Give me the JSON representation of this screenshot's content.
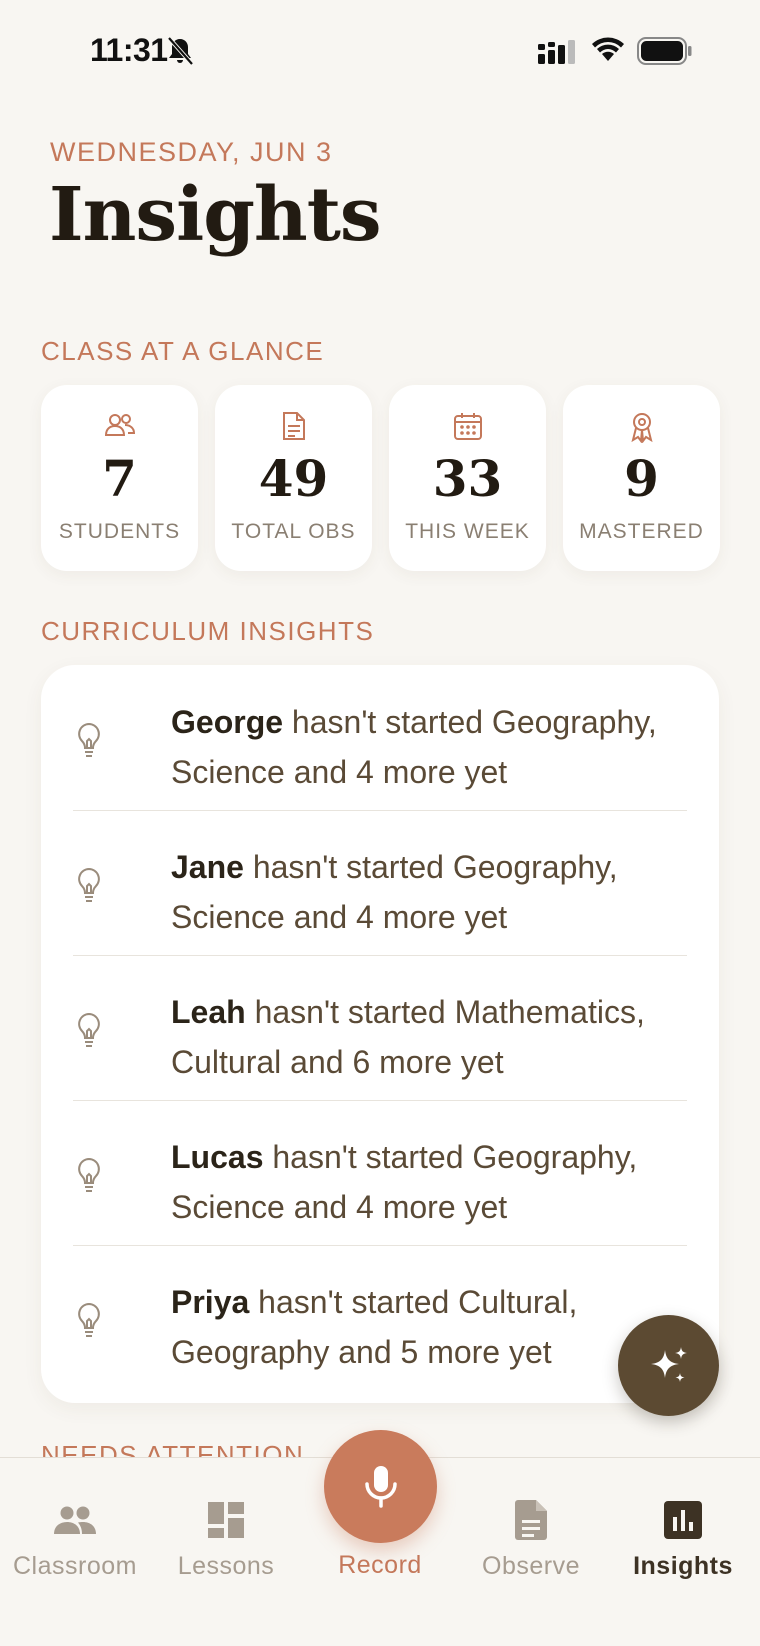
{
  "status_bar": {
    "time": "11:31",
    "icons": [
      "bell-slash-icon",
      "cellular-signal-icon",
      "wifi-icon",
      "battery-icon"
    ]
  },
  "header": {
    "date": "WEDNESDAY, JUN 3",
    "title": "Insights"
  },
  "class_at_a_glance": {
    "label": "CLASS AT A GLANCE",
    "stats": [
      {
        "icon": "students-icon",
        "value": "7",
        "label": "STUDENTS"
      },
      {
        "icon": "document-icon",
        "value": "49",
        "label": "TOTAL OBS"
      },
      {
        "icon": "calendar-icon",
        "value": "33",
        "label": "THIS WEEK"
      },
      {
        "icon": "award-icon",
        "value": "9",
        "label": "MASTERED"
      }
    ]
  },
  "curriculum_insights": {
    "label": "CURRICULUM INSIGHTS",
    "items": [
      {
        "icon": "lightbulb-icon",
        "name": "George",
        "text": " hasn't started Geography, Science and 4 more yet"
      },
      {
        "icon": "lightbulb-icon",
        "name": "Jane",
        "text": " hasn't started Geography, Science and 4 more yet"
      },
      {
        "icon": "lightbulb-icon",
        "name": "Leah",
        "text": " hasn't started Mathematics, Cultural and 6 more yet"
      },
      {
        "icon": "lightbulb-icon",
        "name": "Lucas",
        "text": " hasn't started Geography, Science and 4 more yet"
      },
      {
        "icon": "lightbulb-icon",
        "name": "Priya",
        "text": " hasn't started Cultural, Geography and 5 more yet"
      }
    ]
  },
  "needs_attention": {
    "label": "NEEDS ATTENTION"
  },
  "fab": {
    "icon": "sparkles-icon"
  },
  "tab_bar": {
    "tabs": [
      {
        "icon": "people-icon",
        "label": "Classroom",
        "active": false
      },
      {
        "icon": "dashboard-icon",
        "label": "Lessons",
        "active": false
      },
      {
        "icon": "microphone-icon",
        "label": "Record",
        "active": false
      },
      {
        "icon": "document-icon",
        "label": "Observe",
        "active": false
      },
      {
        "icon": "bar-chart-icon",
        "label": "Insights",
        "active": true
      }
    ]
  },
  "colors": {
    "accent": "#c4785a",
    "record": "#c97b5c",
    "fab": "#5c4a32",
    "background": "#f8f6f2"
  }
}
